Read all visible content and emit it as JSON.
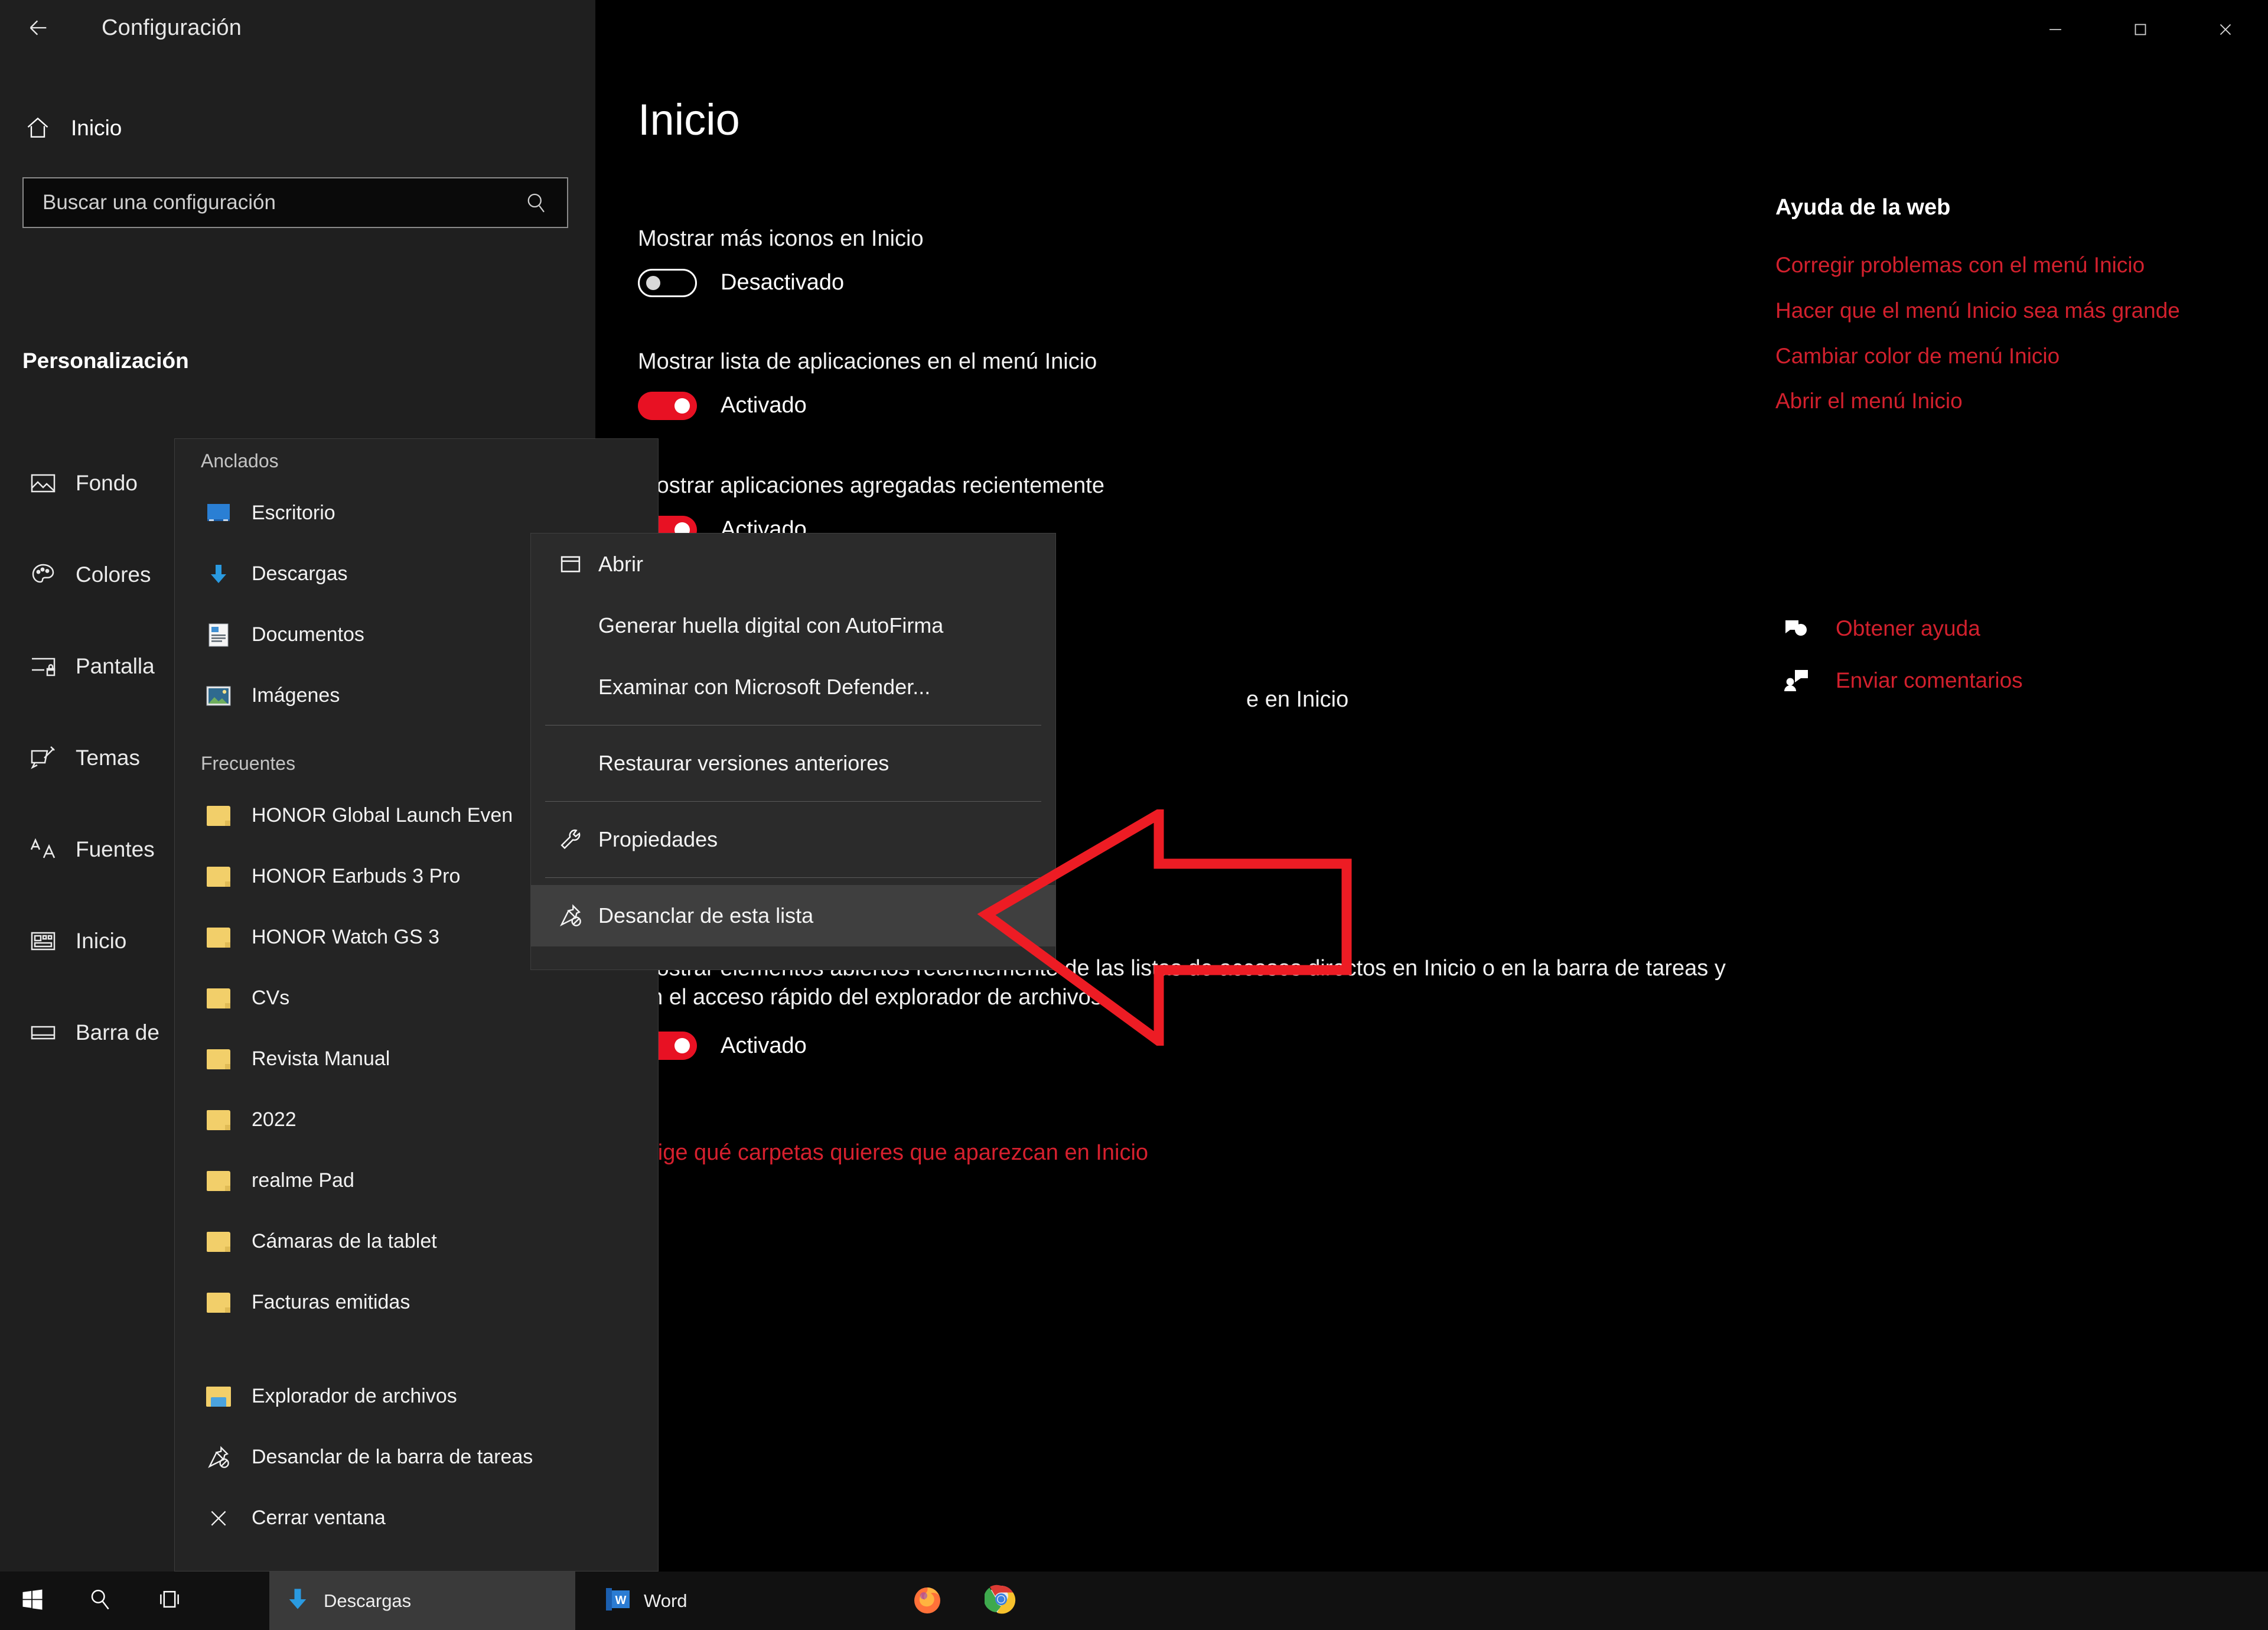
{
  "window": {
    "title": "Configuración",
    "back_icon": "back-arrow-icon",
    "minimize_label": "Minimizar",
    "maximize_label": "Maximizar",
    "close_label": "Cerrar"
  },
  "sidebar": {
    "home": {
      "label": "Inicio",
      "icon": "home-icon"
    },
    "search": {
      "placeholder": "Buscar una configuración",
      "icon": "search-icon"
    },
    "section_title": "Personalización",
    "items": [
      {
        "label": "Fondo",
        "icon": "image-icon"
      },
      {
        "label": "Colores",
        "icon": "palette-icon"
      },
      {
        "label": "Pantalla",
        "icon": "lock-screen-icon"
      },
      {
        "label": "Temas",
        "icon": "theme-brush-icon"
      },
      {
        "label": "Fuentes",
        "icon": "fonts-icon"
      },
      {
        "label": "Inicio",
        "icon": "start-tiles-icon"
      },
      {
        "label": "Barra de",
        "icon": "taskbar-icon"
      }
    ]
  },
  "main": {
    "page_title": "Inicio",
    "settings": [
      {
        "label": "Mostrar más iconos en Inicio",
        "state": "Desactivado",
        "on": false
      },
      {
        "label": "Mostrar lista de aplicaciones en el menú Inicio",
        "state": "Activado",
        "on": true
      },
      {
        "label": "Mostrar aplicaciones agregadas recientemente",
        "state": "Activado",
        "on": true
      },
      {
        "label": "e en Inicio",
        "state": "",
        "on": true
      },
      {
        "label": "Mostrar elementos abiertos recientemente de las listas de accesos directos en Inicio o en la barra de tareas y en el acceso rápido del explorador de archivos",
        "state": "Activado",
        "on": true
      }
    ],
    "folders_link": "Elige qué carpetas quieres que aparezcan en Inicio"
  },
  "help": {
    "title": "Ayuda de la web",
    "links": [
      "Corregir problemas con el menú Inicio",
      "Hacer que el menú Inicio sea más grande",
      "Cambiar color de menú Inicio",
      "Abrir el menú Inicio"
    ],
    "actions": [
      {
        "label": "Obtener ayuda",
        "icon": "help-chat-icon"
      },
      {
        "label": "Enviar comentarios",
        "icon": "feedback-icon"
      }
    ]
  },
  "jumplist": {
    "pinned_header": "Anclados",
    "pinned": [
      {
        "label": "Escritorio",
        "icon": "desktop-icon"
      },
      {
        "label": "Descargas",
        "icon": "download-arrow-icon"
      },
      {
        "label": "Documentos",
        "icon": "document-icon"
      },
      {
        "label": "Imágenes",
        "icon": "picture-icon"
      }
    ],
    "frequent_header": "Frecuentes",
    "frequent": [
      {
        "label": "HONOR Global Launch Even",
        "icon": "folder-icon"
      },
      {
        "label": "HONOR Earbuds 3 Pro",
        "icon": "folder-icon"
      },
      {
        "label": "HONOR Watch GS 3",
        "icon": "folder-icon"
      },
      {
        "label": "CVs",
        "icon": "folder-icon"
      },
      {
        "label": "Revista Manual",
        "icon": "folder-icon"
      },
      {
        "label": "2022",
        "icon": "folder-icon"
      },
      {
        "label": "realme Pad",
        "icon": "folder-icon"
      },
      {
        "label": "Cámaras de la tablet",
        "icon": "folder-icon"
      },
      {
        "label": "Facturas emitidas",
        "icon": "folder-icon"
      }
    ],
    "actions": [
      {
        "label": "Explorador de archivos",
        "icon": "file-explorer-icon"
      },
      {
        "label": "Desanclar de la barra de tareas",
        "icon": "unpin-icon"
      },
      {
        "label": "Cerrar ventana",
        "icon": "close-x-icon"
      }
    ]
  },
  "contextmenu": {
    "items": [
      {
        "label": "Abrir",
        "icon": "window-icon",
        "highlighted": false,
        "separator_after": false
      },
      {
        "label": "Generar huella digital con AutoFirma",
        "icon": "",
        "highlighted": false,
        "separator_after": false
      },
      {
        "label": "Examinar con Microsoft Defender...",
        "icon": "",
        "highlighted": false,
        "separator_after": true
      },
      {
        "label": "Restaurar versiones anteriores",
        "icon": "",
        "highlighted": false,
        "separator_after": true
      },
      {
        "label": "Propiedades",
        "icon": "wrench-icon",
        "highlighted": false,
        "separator_after": true
      },
      {
        "label": "Desanclar de esta lista",
        "icon": "unpin-icon",
        "highlighted": true,
        "separator_after": false
      }
    ]
  },
  "annotation": {
    "shape": "left-pointing-arrow",
    "color": "#ED1C24",
    "target": "Desanclar de esta lista"
  },
  "taskbar": {
    "start_icon": "windows-logo-icon",
    "search_icon": "search-icon",
    "taskview_icon": "task-view-icon",
    "tasks": [
      {
        "label": "Descargas",
        "icon": "download-arrow-icon",
        "active": true
      },
      {
        "label": "Word",
        "icon": "word-icon",
        "active": false
      }
    ],
    "pinned": [
      {
        "label": "Firefox",
        "icon": "firefox-icon"
      },
      {
        "label": "Google Chrome",
        "icon": "chrome-icon"
      }
    ]
  },
  "colors": {
    "accent_red": "#E81123",
    "link_red": "#D2202D",
    "annotation_red": "#ED1C24",
    "sidebar_bg": "#1F1F1F",
    "main_bg": "#000000",
    "menu_bg": "#2B2B2B",
    "jumplist_bg": "#242424"
  }
}
